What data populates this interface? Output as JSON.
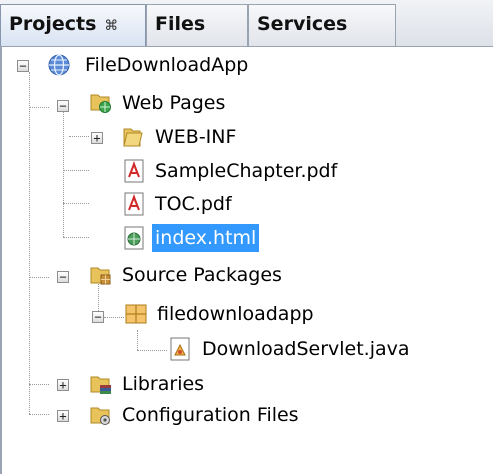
{
  "tabs": [
    {
      "label": "Projects",
      "close": "⌘"
    },
    {
      "label": "Files"
    },
    {
      "label": "Services"
    }
  ],
  "tree": {
    "root": "FileDownloadApp",
    "web_pages": "Web Pages",
    "web_inf": "WEB-INF",
    "sample_chapter": "SampleChapter.pdf",
    "toc": "TOC.pdf",
    "index": "index.html",
    "source_packages": "Source Packages",
    "package": "filedownloadapp",
    "servlet": "DownloadServlet.java",
    "libraries": "Libraries",
    "config_files": "Configuration Files"
  },
  "colors": {
    "selection": "#3399ff",
    "folder": "#e8c25a",
    "pdf": "#d22a2a"
  }
}
